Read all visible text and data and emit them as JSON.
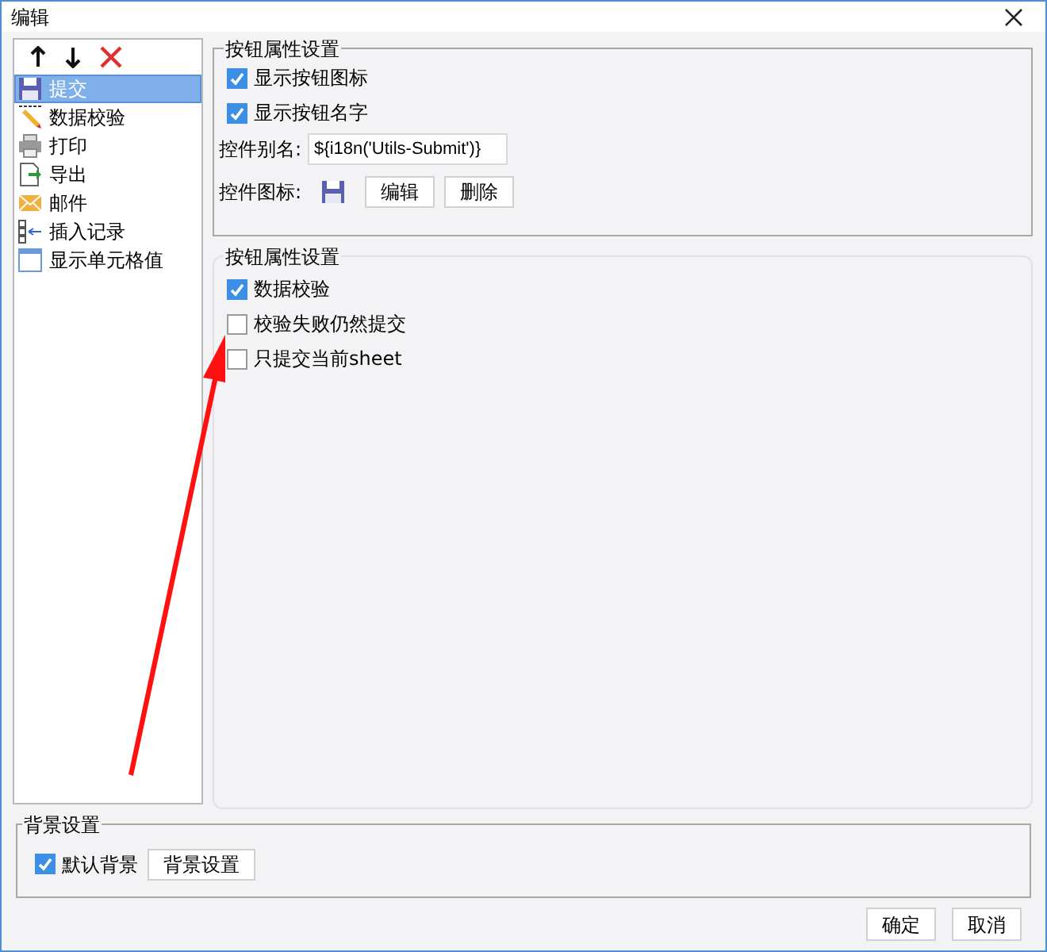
{
  "window": {
    "title": "编辑"
  },
  "items": [
    {
      "label": "提交",
      "kind": "save",
      "selected": true
    },
    {
      "label": "数据校验",
      "kind": "pencil",
      "selected": false
    },
    {
      "label": "打印",
      "kind": "printer",
      "selected": false
    },
    {
      "label": "导出",
      "kind": "export",
      "selected": false
    },
    {
      "label": "邮件",
      "kind": "mail",
      "selected": false
    },
    {
      "label": "插入记录",
      "kind": "insert",
      "selected": false
    },
    {
      "label": "显示单元格值",
      "kind": "cell",
      "selected": false
    }
  ],
  "button_group": {
    "title": "按钮属性设置",
    "options": [
      {
        "label": "显示按钮图标",
        "checked": true
      },
      {
        "label": "显示按钮名字",
        "checked": true
      }
    ],
    "alias": {
      "label": "控件别名:",
      "value": "${i18n('Utils-Submit')}"
    },
    "icon_row": {
      "label": "控件图标:",
      "buttons": [
        "编辑",
        "删除"
      ]
    }
  },
  "validation_group": {
    "title": "按钮属性设置",
    "options": [
      {
        "label": "数据校验",
        "checked": true
      },
      {
        "label": "校验失败仍然提交",
        "checked": false
      },
      {
        "label": "只提交当前sheet",
        "checked": false
      }
    ]
  },
  "background": {
    "title": "背景设置",
    "default_option": {
      "label": "默认背景",
      "checked": true
    },
    "button": "背景设置"
  },
  "buttons": [
    "确定",
    "取消"
  ]
}
